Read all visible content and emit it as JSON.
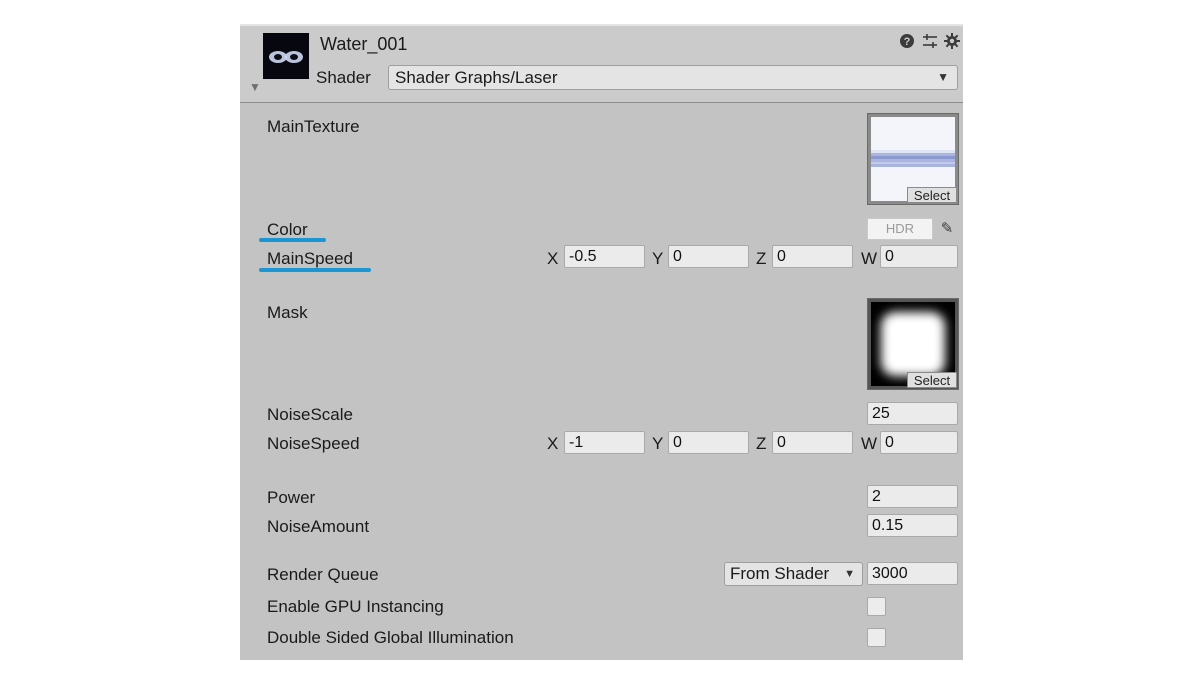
{
  "material": {
    "name": "Water_001",
    "shader_label": "Shader",
    "shader_value": "Shader Graphs/Laser"
  },
  "header_icons": [
    "help-icon",
    "presets-icon",
    "settings-gear-icon"
  ],
  "properties": {
    "main_texture": {
      "label": "MainTexture",
      "select_label": "Select"
    },
    "color": {
      "label": "Color",
      "hdr_label": "HDR"
    },
    "main_speed": {
      "label": "MainSpeed",
      "x_label": "X",
      "x": "-0.5",
      "y_label": "Y",
      "y": "0",
      "z_label": "Z",
      "z": "0",
      "w_label": "W",
      "w": "0"
    },
    "mask": {
      "label": "Mask",
      "select_label": "Select"
    },
    "noise_scale": {
      "label": "NoiseScale",
      "value": "25"
    },
    "noise_speed": {
      "label": "NoiseSpeed",
      "x_label": "X",
      "x": "-1",
      "y_label": "Y",
      "y": "0",
      "z_label": "Z",
      "z": "0",
      "w_label": "W",
      "w": "0"
    },
    "power": {
      "label": "Power",
      "value": "2"
    },
    "noise_amount": {
      "label": "NoiseAmount",
      "value": "0.15"
    }
  },
  "advanced": {
    "render_queue": {
      "label": "Render Queue",
      "mode": "From Shader",
      "value": "3000"
    },
    "gpu_instancing": {
      "label": "Enable GPU Instancing",
      "checked": false
    },
    "double_sided_gi": {
      "label": "Double Sided Global Illumination",
      "checked": false
    }
  },
  "highlight_color": "#1a96d4"
}
